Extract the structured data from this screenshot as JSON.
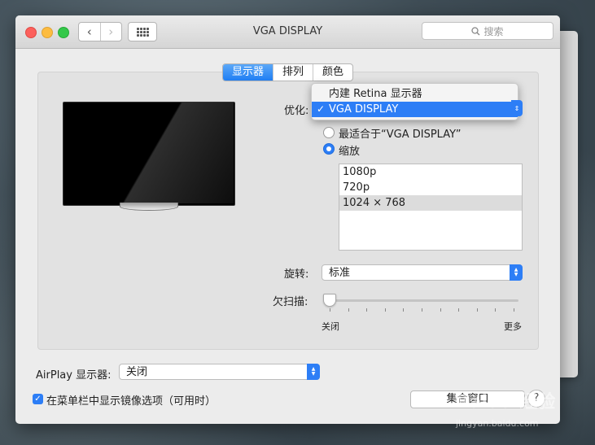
{
  "window": {
    "title": "VGA DISPLAY"
  },
  "search": {
    "placeholder": "搜索"
  },
  "tabs": [
    {
      "label": "显示器",
      "active": true
    },
    {
      "label": "排列",
      "active": false
    },
    {
      "label": "颜色",
      "active": false
    }
  ],
  "optimize": {
    "label": "优化:",
    "menu": [
      {
        "label": "内建 Retina 显示器",
        "selected": false
      },
      {
        "label": "VGA DISPLAY",
        "selected": true
      }
    ]
  },
  "resolution": {
    "best_label": "最适合于“VGA DISPLAY”",
    "scaled_label": "缩放",
    "selected_option": "scaled",
    "options": [
      "1080p",
      "720p",
      "1024 × 768"
    ],
    "selected_index": 2
  },
  "rotation": {
    "label": "旋转:",
    "value": "标准"
  },
  "underscan": {
    "label": "欠扫描:",
    "min_label": "关闭",
    "max_label": "更多",
    "value": 0
  },
  "airplay": {
    "label": "AirPlay 显示器:",
    "value": "关闭"
  },
  "mirror_checkbox": {
    "label": "在菜单栏中显示镜像选项（可用时）",
    "checked": true
  },
  "buttons": {
    "gather_windows": "集合窗口",
    "help": "?"
  },
  "colors": {
    "accent": "#2d7ef6",
    "close": "#fc605c",
    "minimize": "#fdbc40",
    "maximize": "#34c84a"
  },
  "watermark": {
    "main": "Baidu 经验",
    "sub": "jingyan.baidu.com"
  }
}
